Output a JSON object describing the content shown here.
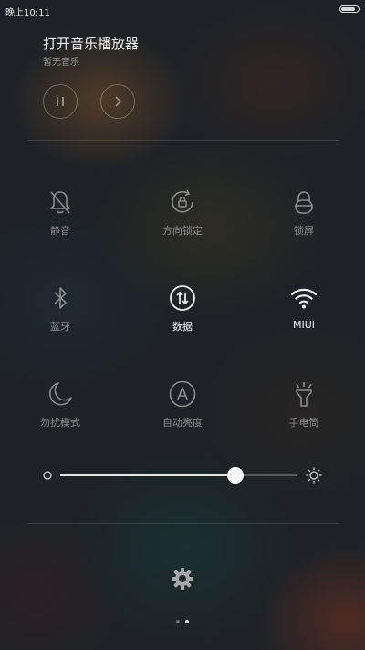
{
  "statusbar": {
    "time": "晚上10:11",
    "battery_level": 0.85
  },
  "music": {
    "title": "打开音乐播放器",
    "subtitle": "暂无音乐",
    "pause_icon": "pause-icon",
    "next_icon": "chevron-right-icon"
  },
  "toggles": [
    {
      "label": "静音",
      "icon": "bell-off-icon",
      "active": false
    },
    {
      "label": "方向锁定",
      "icon": "rotation-lock-icon",
      "active": false
    },
    {
      "label": "锁屏",
      "icon": "lock-icon",
      "active": false
    },
    {
      "label": "蓝牙",
      "icon": "bluetooth-icon",
      "active": false
    },
    {
      "label": "数据",
      "icon": "mobile-data-icon",
      "active": true
    },
    {
      "label": "MIUI",
      "icon": "wifi-icon",
      "active": true
    },
    {
      "label": "勿扰模式",
      "icon": "moon-icon",
      "active": false
    },
    {
      "label": "自动亮度",
      "icon": "auto-brightness-icon",
      "active": false
    },
    {
      "label": "手电筒",
      "icon": "flashlight-icon",
      "active": false
    }
  ],
  "brightness": {
    "level": 0.74,
    "min_icon": "brightness-low-icon",
    "max_icon": "brightness-high-icon"
  },
  "settings": {
    "icon": "gear-icon"
  },
  "pager": {
    "count": 2,
    "active": 1
  }
}
